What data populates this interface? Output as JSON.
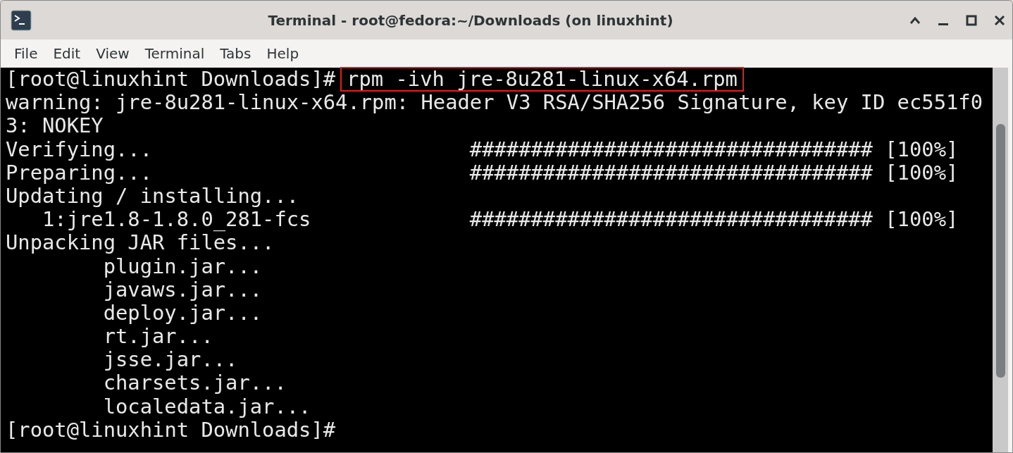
{
  "window": {
    "title": "Terminal - root@fedora:~/Downloads (on linuxhint)"
  },
  "menu": [
    "File",
    "Edit",
    "View",
    "Terminal",
    "Tabs",
    "Help"
  ],
  "terminal": {
    "lines": [
      {
        "kind": "prompt",
        "prompt": "[root@linuxhint Downloads]#",
        "command": "rpm -ivh jre-8u281-linux-x64.rpm",
        "highlighted": true
      },
      {
        "kind": "output",
        "text": "warning: jre-8u281-linux-x64.rpm: Header V3 RSA/SHA256 Signature, key ID ec551f0"
      },
      {
        "kind": "output",
        "text": "3: NOKEY"
      },
      {
        "kind": "progress",
        "label": "Verifying...",
        "bar": "#################################",
        "percent": "[100%]",
        "indented": false
      },
      {
        "kind": "progress",
        "label": "Preparing...",
        "bar": "#################################",
        "percent": "[100%]",
        "indented": false
      },
      {
        "kind": "output",
        "text": "Updating / installing..."
      },
      {
        "kind": "progress",
        "label": "1:jre1.8-1.8.0_281-fcs",
        "bar": "#################################",
        "percent": "[100%]",
        "indented": true
      },
      {
        "kind": "output",
        "text": "Unpacking JAR files..."
      },
      {
        "kind": "file",
        "text": "plugin.jar..."
      },
      {
        "kind": "file",
        "text": "javaws.jar..."
      },
      {
        "kind": "file",
        "text": "deploy.jar..."
      },
      {
        "kind": "file",
        "text": "rt.jar..."
      },
      {
        "kind": "file",
        "text": "jsse.jar..."
      },
      {
        "kind": "file",
        "text": "charsets.jar..."
      },
      {
        "kind": "file",
        "text": "localedata.jar..."
      },
      {
        "kind": "prompt",
        "prompt": "[root@linuxhint Downloads]#"
      }
    ]
  }
}
